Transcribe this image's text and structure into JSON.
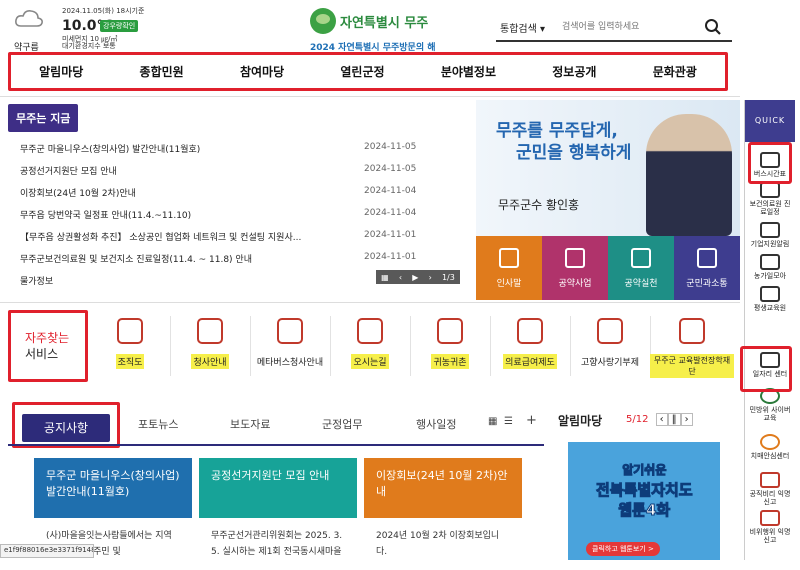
{
  "weather": {
    "date": "2024.11.05(화) 18시기준",
    "temp": "10.0℃",
    "badge": "강우량확인",
    "condition": "약구름",
    "dust_line1": "미세먼지 10 ㎍/㎥",
    "dust_line2": "대기환경지수 보통"
  },
  "logo": {
    "name": "자연특별시 무주",
    "slogan": "2024 자연특별시 무주방문의 해"
  },
  "search": {
    "scope": "통합검색",
    "placeholder": "검색어를 입력하세요"
  },
  "nav": [
    "알림마당",
    "종합민원",
    "참여마당",
    "열린군정",
    "분야별정보",
    "정보공개",
    "문화관광"
  ],
  "news": {
    "tag": "무주는 지금",
    "items": [
      {
        "title": "무주군 마을니우스(창의사업) 발간안내(11월호)",
        "date": "2024-11-05"
      },
      {
        "title": "공정선거지원단 모집 안내",
        "date": "2024-11-05"
      },
      {
        "title": "이장회보(24년 10월 2차)안내",
        "date": "2024-11-04"
      },
      {
        "title": "무주읍 당번약국 일정표 안내(11.4.~11.10)",
        "date": "2024-11-04"
      },
      {
        "title": "【무주읍 상권활성화 추진】 소상공인 협업화 네트워크 및 컨설팅 지원사...",
        "date": "2024-11-01"
      },
      {
        "title": "무주군보건의료원 및 보건지소 진료일정(11.4. ~ 11.8) 안내",
        "date": "2024-11-01"
      },
      {
        "title": "물가정보",
        "date": ""
      }
    ]
  },
  "banner": {
    "slogan1": "무주를 무주답게,",
    "slogan2": "군민을 행복하게",
    "mayor": "무주군수 황인홍",
    "tiles": [
      {
        "label": "인사말",
        "color": "#e07b1c"
      },
      {
        "label": "공약사업",
        "color": "#b0336b"
      },
      {
        "label": "공약실천",
        "color": "#1e8f86"
      },
      {
        "label": "군민과소통",
        "color": "#3e3d8f"
      }
    ],
    "pager": "1/3"
  },
  "services": {
    "title_a": "자주찾는",
    "title_b": "서비스",
    "items": [
      {
        "label": "조직도",
        "hl": true
      },
      {
        "label": "청사안내",
        "hl": true
      },
      {
        "label": "메타버스청사안내",
        "hl": false
      },
      {
        "label": "오시는길",
        "hl": true
      },
      {
        "label": "귀농귀촌",
        "hl": true
      },
      {
        "label": "의료급여제도",
        "hl": true
      },
      {
        "label": "고향사랑기부제",
        "hl": false
      },
      {
        "label": "무주군 교육발전장학재단",
        "hl": true
      }
    ]
  },
  "tabs": {
    "active": "공지사항",
    "others": [
      "포토뉴스",
      "보도자료",
      "군정업무",
      "행사일정"
    ]
  },
  "cards": [
    {
      "title": "무주군 마을니우스(창의사업) 발간안내(11월호)",
      "body": "(사)마을을잇는사람들에서는 지역 식과 정보를 주민 및",
      "color": "#1f6fae"
    },
    {
      "title": "공정선거지원단 모집 안내",
      "body": "무주군선거관리위원회는 2025. 3. 5. 실시하는 제1회 전국동시새마을",
      "color": "#17a398"
    },
    {
      "title": "이장회보(24년 10월 2차)안내",
      "body": "2024년 10월 2차 이장회보입니다.",
      "color": "#e07b1c"
    }
  ],
  "almaeum": {
    "title": "알림마당",
    "count": "5/12",
    "poster_line1": "알기쉬운",
    "poster_line2": "전북특별자치도",
    "poster_line3": "웹툰4화",
    "poster_btn": "클릭하고 웹툰보기 >"
  },
  "quick": {
    "head": "QUICK",
    "items": [
      "버스시간표",
      "보건의료원 진료일정",
      "기업지원알림",
      "농가일모아",
      "평생교육원",
      "일자리 센터",
      "민방위 사이버교육",
      "치매안심센터",
      "공직비리 익명신고",
      "비위행위 익명신고"
    ]
  },
  "status": "e1f9f88016e3e3371f91480"
}
